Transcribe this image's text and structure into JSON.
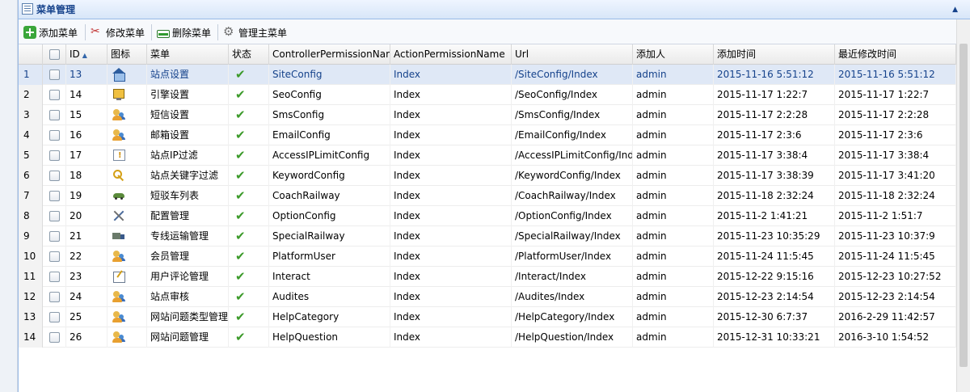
{
  "panel": {
    "title": "菜单管理"
  },
  "toolbar": {
    "add_label": "添加菜单",
    "edit_label": "修改菜单",
    "delete_label": "删除菜单",
    "manage_label": "管理主菜单"
  },
  "columns": {
    "id": "ID",
    "icon": "图标",
    "menu": "菜单",
    "status": "状态",
    "controller": "ControllerPermissionName",
    "action": "ActionPermissionName",
    "url": "Url",
    "creator": "添加人",
    "created": "添加时间",
    "modified": "最近修改时间"
  },
  "rows": [
    {
      "num": "1",
      "id": "13",
      "icon": "house-icon",
      "menu": "站点设置",
      "controller": "SiteConfig",
      "action": "Index",
      "url": "/SiteConfig/Index",
      "creator": "admin",
      "created": "2015-11-16 5:51:12",
      "modified": "2015-11-16 5:51:12",
      "selected": true
    },
    {
      "num": "2",
      "id": "14",
      "icon": "monitor-icon",
      "menu": "引擎设置",
      "controller": "SeoConfig",
      "action": "Index",
      "url": "/SeoConfig/Index",
      "creator": "admin",
      "created": "2015-11-17 1:22:7",
      "modified": "2015-11-17 1:22:7"
    },
    {
      "num": "3",
      "id": "15",
      "icon": "users-icon",
      "menu": "短信设置",
      "controller": "SmsConfig",
      "action": "Index",
      "url": "/SmsConfig/Index",
      "creator": "admin",
      "created": "2015-11-17 2:2:28",
      "modified": "2015-11-17 2:2:28"
    },
    {
      "num": "4",
      "id": "16",
      "icon": "users-icon",
      "menu": "邮箱设置",
      "controller": "EmailConfig",
      "action": "Index",
      "url": "/EmailConfig/Index",
      "creator": "admin",
      "created": "2015-11-17 2:3:6",
      "modified": "2015-11-17 2:3:6"
    },
    {
      "num": "5",
      "id": "17",
      "icon": "alert-icon",
      "menu": "站点IP过滤",
      "controller": "AccessIPLimitConfig",
      "action": "Index",
      "url": "/AccessIPLimitConfig/Index",
      "creator": "admin",
      "created": "2015-11-17 3:38:4",
      "modified": "2015-11-17 3:38:4"
    },
    {
      "num": "6",
      "id": "18",
      "icon": "key-icon",
      "menu": "站点关键字过滤",
      "controller": "KeywordConfig",
      "action": "Index",
      "url": "/KeywordConfig/Index",
      "creator": "admin",
      "created": "2015-11-17 3:38:39",
      "modified": "2015-11-17 3:41:20"
    },
    {
      "num": "7",
      "id": "19",
      "icon": "car-icon",
      "menu": "短驳车列表",
      "controller": "CoachRailway",
      "action": "Index",
      "url": "/CoachRailway/Index",
      "creator": "admin",
      "created": "2015-11-18 2:32:24",
      "modified": "2015-11-18 2:32:24"
    },
    {
      "num": "8",
      "id": "20",
      "icon": "tools-icon",
      "menu": "配置管理",
      "controller": "OptionConfig",
      "action": "Index",
      "url": "/OptionConfig/Index",
      "creator": "admin",
      "created": "2015-11-2 1:41:21",
      "modified": "2015-11-2 1:51:7"
    },
    {
      "num": "9",
      "id": "21",
      "icon": "truck-icon",
      "menu": "专线运输管理",
      "controller": "SpecialRailway",
      "action": "Index",
      "url": "/SpecialRailway/Index",
      "creator": "admin",
      "created": "2015-11-23 10:35:29",
      "modified": "2015-11-23 10:37:9"
    },
    {
      "num": "10",
      "id": "22",
      "icon": "users-icon",
      "menu": "会员管理",
      "controller": "PlatformUser",
      "action": "Index",
      "url": "/PlatformUser/Index",
      "creator": "admin",
      "created": "2015-11-24 11:5:45",
      "modified": "2015-11-24 11:5:45"
    },
    {
      "num": "11",
      "id": "23",
      "icon": "note-icon",
      "menu": "用户评论管理",
      "controller": "Interact",
      "action": "Index",
      "url": "/Interact/Index",
      "creator": "admin",
      "created": "2015-12-22 9:15:16",
      "modified": "2015-12-23 10:27:52"
    },
    {
      "num": "12",
      "id": "24",
      "icon": "users-icon",
      "menu": "站点审核",
      "controller": "Audites",
      "action": "Index",
      "url": "/Audites/Index",
      "creator": "admin",
      "created": "2015-12-23 2:14:54",
      "modified": "2015-12-23 2:14:54"
    },
    {
      "num": "13",
      "id": "25",
      "icon": "users-icon",
      "menu": "网站问题类型管理",
      "controller": "HelpCategory",
      "action": "Index",
      "url": "/HelpCategory/Index",
      "creator": "admin",
      "created": "2015-12-30 6:7:37",
      "modified": "2016-2-29 11:42:57"
    },
    {
      "num": "14",
      "id": "26",
      "icon": "users-icon",
      "menu": "网站问题管理",
      "controller": "HelpQuestion",
      "action": "Index",
      "url": "/HelpQuestion/Index",
      "creator": "admin",
      "created": "2015-12-31 10:33:21",
      "modified": "2016-3-10 1:54:52"
    }
  ],
  "colors": {
    "header_text": "#15428b",
    "selected_row": "#dfe8f6",
    "status_ok": "#3c9a2a"
  }
}
